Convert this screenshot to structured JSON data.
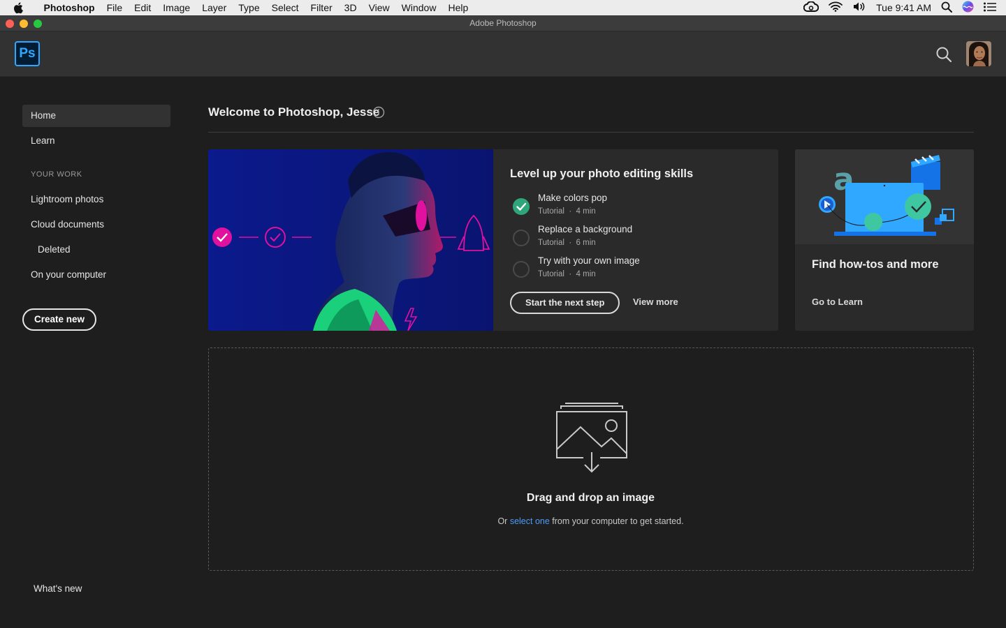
{
  "menubar": {
    "app_name": "Photoshop",
    "items": [
      "File",
      "Edit",
      "Image",
      "Layer",
      "Type",
      "Select",
      "Filter",
      "3D",
      "View",
      "Window",
      "Help"
    ],
    "clock": "Tue 9:41 AM"
  },
  "window": {
    "title": "Adobe Photoshop"
  },
  "header": {
    "logo_text": "Ps"
  },
  "sidebar": {
    "home": "Home",
    "learn": "Learn",
    "section_label": "YOUR WORK",
    "lightroom": "Lightroom photos",
    "cloud": "Cloud documents",
    "deleted": "Deleted",
    "computer": "On your computer",
    "create_new": "Create new",
    "whats_new": "What's new"
  },
  "main": {
    "welcome": "Welcome to Photoshop, Jesse",
    "tutorial_card": {
      "title": "Level up your photo editing skills",
      "steps": [
        {
          "name": "Make colors pop",
          "type": "Tutorial",
          "duration": "4 min",
          "done": true
        },
        {
          "name": "Replace a background",
          "type": "Tutorial",
          "duration": "6 min",
          "done": false
        },
        {
          "name": "Try with your own image",
          "type": "Tutorial",
          "duration": "4 min",
          "done": false
        }
      ],
      "separator": "·",
      "start_button": "Start the next step",
      "view_more": "View more"
    },
    "learn_card": {
      "title": "Find how-tos and more",
      "link": "Go to Learn"
    },
    "dropzone": {
      "title": "Drag and drop an image",
      "prefix": "Or ",
      "link": "select one",
      "suffix": " from your computer to get started."
    }
  },
  "colors": {
    "accent": "#31a8ff",
    "link": "#4b9cf5",
    "done_check": "#2fa67a",
    "magenta": "#e0119f"
  }
}
